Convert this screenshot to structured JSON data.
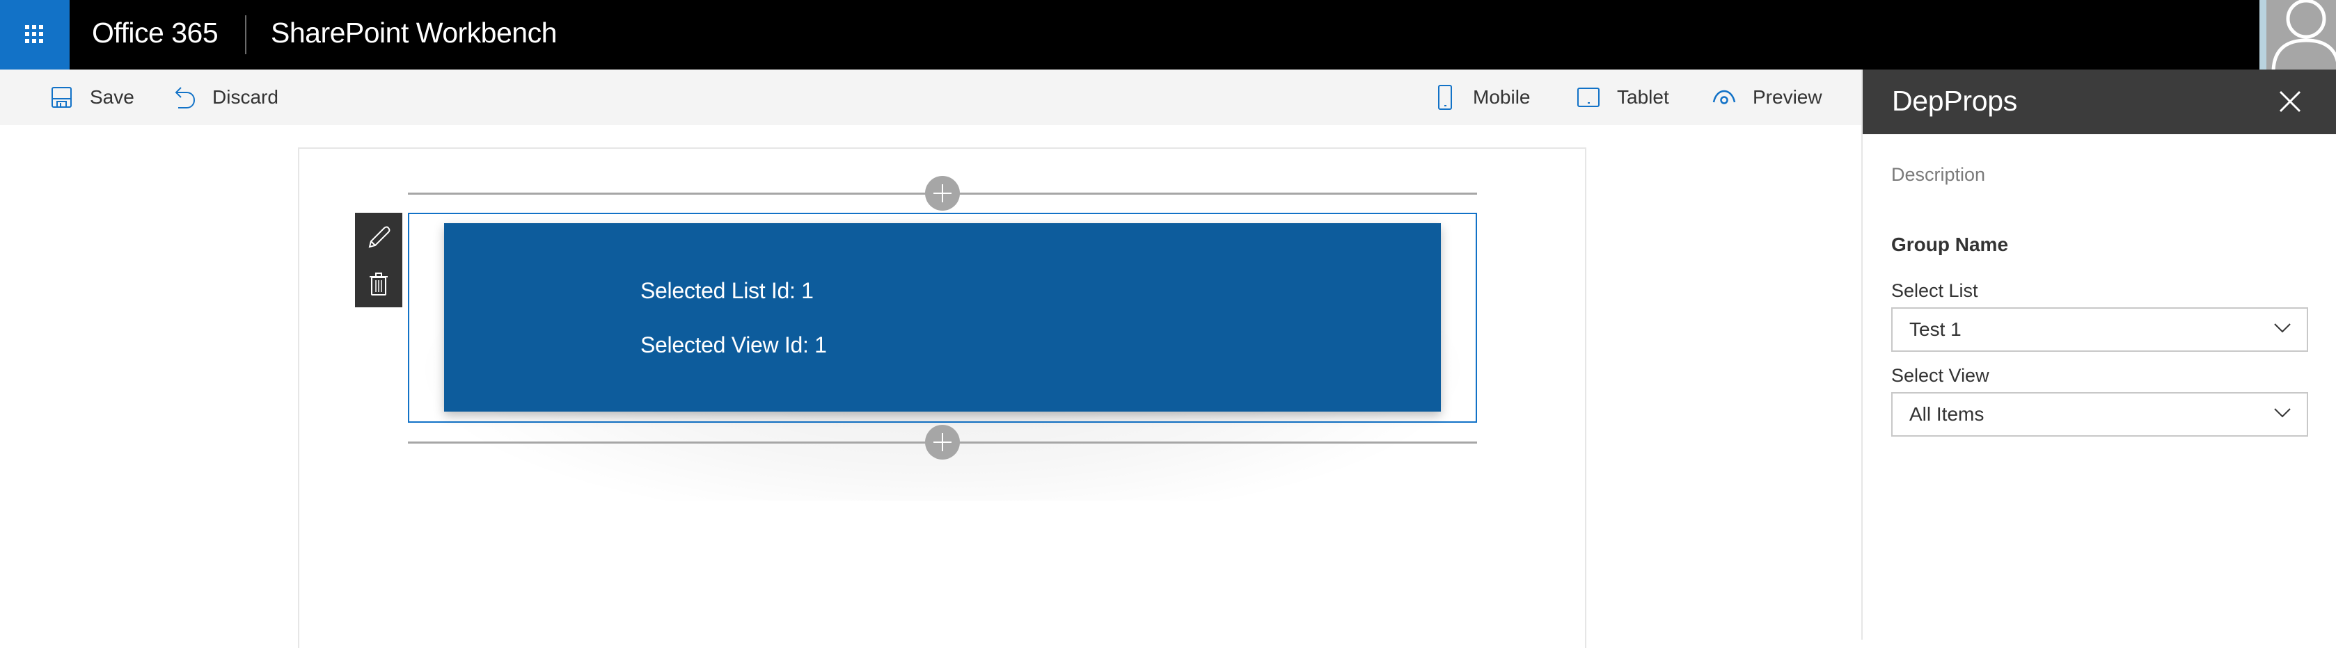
{
  "suitebar": {
    "waffle_icon": "app-launcher-icon",
    "brand": "Office 365",
    "app_title": "SharePoint Workbench",
    "avatar_icon": "user-avatar-icon",
    "colors": {
      "bar": "#000000",
      "waffle": "#1272c7"
    }
  },
  "toolbar": {
    "save_label": "Save",
    "discard_label": "Discard",
    "mobile_label": "Mobile",
    "tablet_label": "Tablet",
    "preview_label": "Preview",
    "icons": {
      "save": "save-icon",
      "discard": "undo-icon",
      "mobile": "mobile-icon",
      "tablet": "tablet-icon",
      "preview": "eye-icon"
    },
    "accent": "#1272c7"
  },
  "webpart": {
    "list_id_text": "Selected List Id: 1",
    "view_id_text": "Selected View Id: 1",
    "edit_icon": "pencil-icon",
    "delete_icon": "trash-icon",
    "add_icon": "plus-icon",
    "colors": {
      "body": "#0d5c9c",
      "selection_border": "#1272c7"
    }
  },
  "property_pane": {
    "title": "DepProps",
    "close_icon": "close-icon",
    "description": "Description",
    "group_name": "Group Name",
    "fields": [
      {
        "label": "Select List",
        "value": "Test 1"
      },
      {
        "label": "Select View",
        "value": "All Items"
      }
    ],
    "colors": {
      "header": "#3c3c3c"
    }
  }
}
